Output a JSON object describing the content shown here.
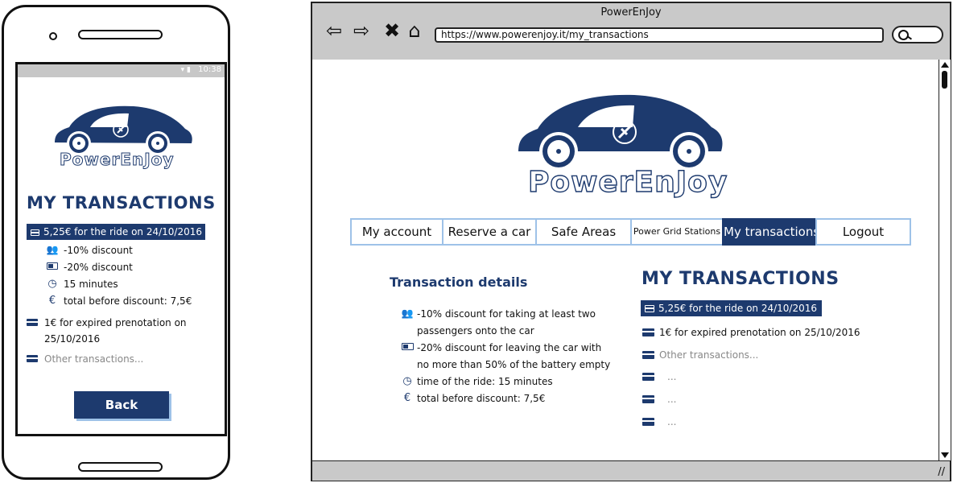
{
  "phone": {
    "status": {
      "signal": "▾ ▮",
      "time": "10:38"
    },
    "logo_text": "PowerEnJoy",
    "page_title": "MY TRANSACTIONS",
    "selected_transaction": "5,25€ for the ride on 24/10/2016",
    "details": [
      {
        "icon": "people-icon",
        "glyph": "👥",
        "text": "-10% discount"
      },
      {
        "icon": "battery-icon",
        "glyph": "▭",
        "text": "-20% discount"
      },
      {
        "icon": "clock-icon",
        "glyph": "◷",
        "text": "15 minutes"
      },
      {
        "icon": "euro-icon",
        "glyph": "€",
        "text": "total before discount: 7,5€"
      }
    ],
    "other_transaction_line1": "1€ for expired prenotation on",
    "other_transaction_line2": "25/10/2016",
    "more_link": "Other transactions...",
    "back_button": "Back"
  },
  "browser": {
    "window_title": "PowerEnJoy",
    "url": "https://www.powerenjoy.it/my_transactions",
    "logo_text": "PowerEnJoy",
    "nav": [
      {
        "label": "My account",
        "active": false,
        "small": false
      },
      {
        "label": "Reserve a car",
        "active": false,
        "small": false
      },
      {
        "label": "Safe Areas",
        "active": false,
        "small": false
      },
      {
        "label": "Power Grid Stations",
        "active": false,
        "small": true
      },
      {
        "label": "My transactions",
        "active": true,
        "small": false
      },
      {
        "label": "Logout",
        "active": false,
        "small": false
      }
    ],
    "details_title": "Transaction details",
    "details": [
      {
        "icon": "people-icon",
        "glyph": "👥",
        "line1": "-10% discount for taking at least two",
        "line2": "passengers onto the car"
      },
      {
        "icon": "battery-icon",
        "glyph": "▭",
        "line1": "-20% discount for leaving the car with",
        "line2": "no more than 50% of the battery empty"
      },
      {
        "icon": "clock-icon",
        "glyph": "◷",
        "line1": "time of the ride: 15 minutes"
      },
      {
        "icon": "euro-icon",
        "glyph": "€",
        "line1": "total before discount: 7,5€"
      }
    ],
    "transactions_title": "MY TRANSACTIONS",
    "transactions": {
      "selected": "5,25€ for the ride on 24/10/2016",
      "second": "1€ for expired prenotation on 25/10/2016",
      "more": "Other transactions...",
      "placeholders": [
        "...",
        "...",
        "..."
      ]
    }
  },
  "colors": {
    "brand": "#1d3a6e",
    "nav_border": "#9ec2e8",
    "chrome": "#c9c9c9"
  }
}
